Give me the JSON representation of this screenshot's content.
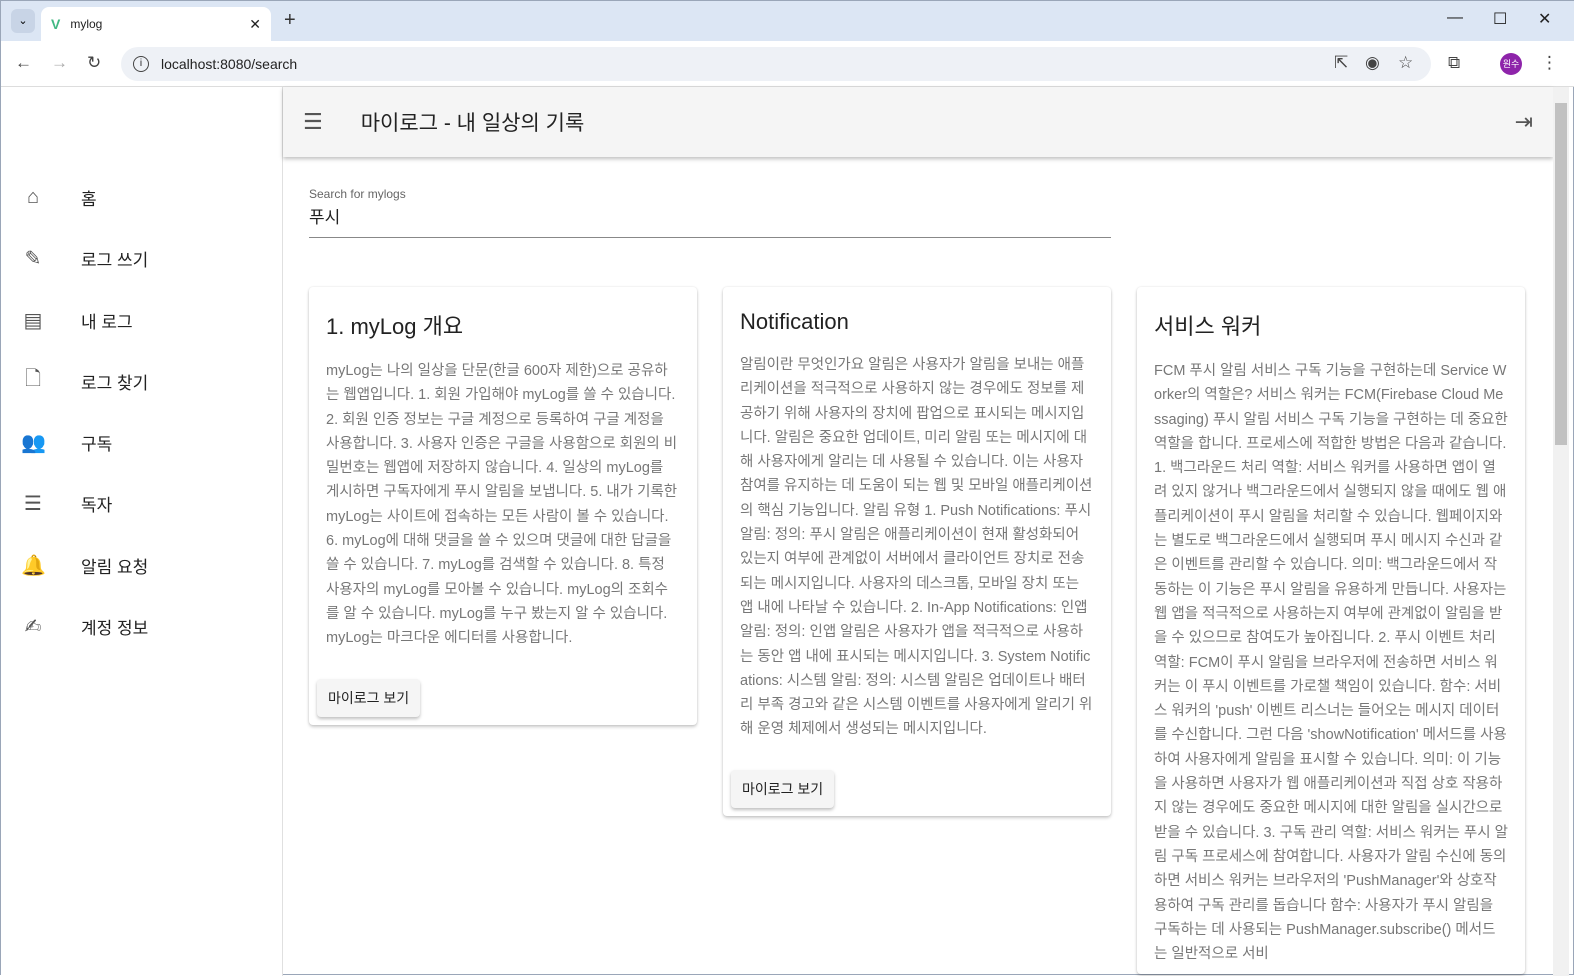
{
  "browser": {
    "tab_title": "mylog",
    "url": "localhost:8080/search",
    "profile": "원수"
  },
  "header": {
    "title": "마이로그 - 내 일상의 기록"
  },
  "sidebar": {
    "items": [
      {
        "label": "홈",
        "icon": "home-icon"
      },
      {
        "label": "로그 쓰기",
        "icon": "pencil-icon"
      },
      {
        "label": "내 로그",
        "icon": "list-icon"
      },
      {
        "label": "로그 찾기",
        "icon": "search-file-icon"
      },
      {
        "label": "구독",
        "icon": "people-icon"
      },
      {
        "label": "독자",
        "icon": "person-list-icon"
      },
      {
        "label": "알림 요청",
        "icon": "bell-icon"
      },
      {
        "label": "계정 정보",
        "icon": "account-edit-icon"
      }
    ]
  },
  "search": {
    "label": "Search for mylogs",
    "value": "푸시"
  },
  "cards": [
    {
      "title": "1. myLog 개요",
      "body": "myLog는 나의 일상을 단문(한글 600자 제한)으로 공유하는 웹앱입니다. 1. 회원 가입해야 myLog를 쓸 수 있습니다. 2. 회원 인증 정보는 구글 계정으로 등록하여 구글 계정을 사용합니다. 3. 사용자 인증은 구글을 사용함으로 회원의 비밀번호는 웹앱에 저장하지 않습니다. 4. 일상의 myLog를 게시하면 구독자에게 푸시 알림을 보냅니다. 5. 내가 기록한 myLog는 사이트에 접속하는 모든 사람이 볼 수 있습니다. 6. myLog에 대해 댓글을 쓸 수 있으며 댓글에 대한 답글을 쓸 수 있습니다. 7. myLog를 검색할 수 있습니다. 8. 특정 사용자의 myLog를 모아볼 수 있습니다. myLog의 조회수를 알 수 있습니다. myLog를 누구 봤는지 알 수 있습니다. myLog는 마크다운 에디터를 사용합니다.",
      "button": "마이로그 보기"
    },
    {
      "title": "Notification",
      "body": "알림이란 무엇인가요 알림은 사용자가 알림을 보내는 애플리케이션을 적극적으로 사용하지 않는 경우에도 정보를 제공하기 위해 사용자의 장치에 팝업으로 표시되는 메시지입니다. 알림은 중요한 업데이트, 미리 알림 또는 메시지에 대해 사용자에게 알리는 데 사용될 수 있습니다. 이는 사용자 참여를 유지하는 데 도움이 되는 웹 및 모바일 애플리케이션의 핵심 기능입니다. 알림 유형 1. Push Notifications: 푸시 알림: 정의: 푸시 알림은 애플리케이션이 현재 활성화되어 있는지 여부에 관계없이 서버에서 클라이언트 장치로 전송되는 메시지입니다. 사용자의 데스크톱, 모바일 장치 또는 앱 내에 나타날 수 있습니다. 2. In-App Notifications: 인앱 알림: 정의: 인앱 알림은 사용자가 앱을 적극적으로 사용하는 동안 앱 내에 표시되는 메시지입니다. 3. System Notifications: 시스템 알림: 정의: 시스템 알림은 업데이트나 배터리 부족 경고와 같은 시스템 이벤트를 사용자에게 알리기 위해 운영 체제에서 생성되는 메시지입니다.",
      "button": "마이로그 보기"
    },
    {
      "title": "서비스 워커",
      "body": "FCM 푸시 알림 서비스 구독 기능을 구현하는데 Service Worker의 역할은? 서비스 워커는 FCM(Firebase Cloud Messaging) 푸시 알림 서비스 구독 기능을 구현하는 데 중요한 역할을 합니다. 프로세스에 적합한 방법은 다음과 같습니다. 1. 백그라운드 처리 역할: 서비스 워커를 사용하면 앱이 열려 있지 않거나 백그라운드에서 실행되지 않을 때에도 웹 애플리케이션이 푸시 알림을 처리할 수 있습니다. 웹페이지와는 별도로 백그라운드에서 실행되며 푸시 메시지 수신과 같은 이벤트를 관리할 수 있습니다. 의미: 백그라운드에서 작동하는 이 기능은 푸시 알림을 유용하게 만듭니다. 사용자는 웹 앱을 적극적으로 사용하는지 여부에 관계없이 알림을 받을 수 있으므로 참여도가 높아집니다. 2. 푸시 이벤트 처리 역할: FCM이 푸시 알림을 브라우저에 전송하면 서비스 워커는 이 푸시 이벤트를 가로챌 책임이 있습니다. 함수: 서비스 워커의 'push' 이벤트 리스너는 들어오는 메시지 데이터를 수신합니다. 그런 다음 'showNotification' 메서드를 사용하여 사용자에게 알림을 표시할 수 있습니다. 의미: 이 기능을 사용하면 사용자가 웹 애플리케이션과 직접 상호 작용하지 않는 경우에도 중요한 메시지에 대한 알림을 실시간으로 받을 수 있습니다. 3. 구독 관리 역할: 서비스 워커는 푸시 알림 구독 프로세스에 참여합니다. 사용자가 알림 수신에 동의하면 서비스 워커는 브라우저의 'PushManager'와 상호작용하여 구독 관리를 돕습니다 함수: 사용자가 푸시 알림을 구독하는 데 사용되는 PushManager.subscribe() 메서드는 일반적으로 서비"
    }
  ]
}
